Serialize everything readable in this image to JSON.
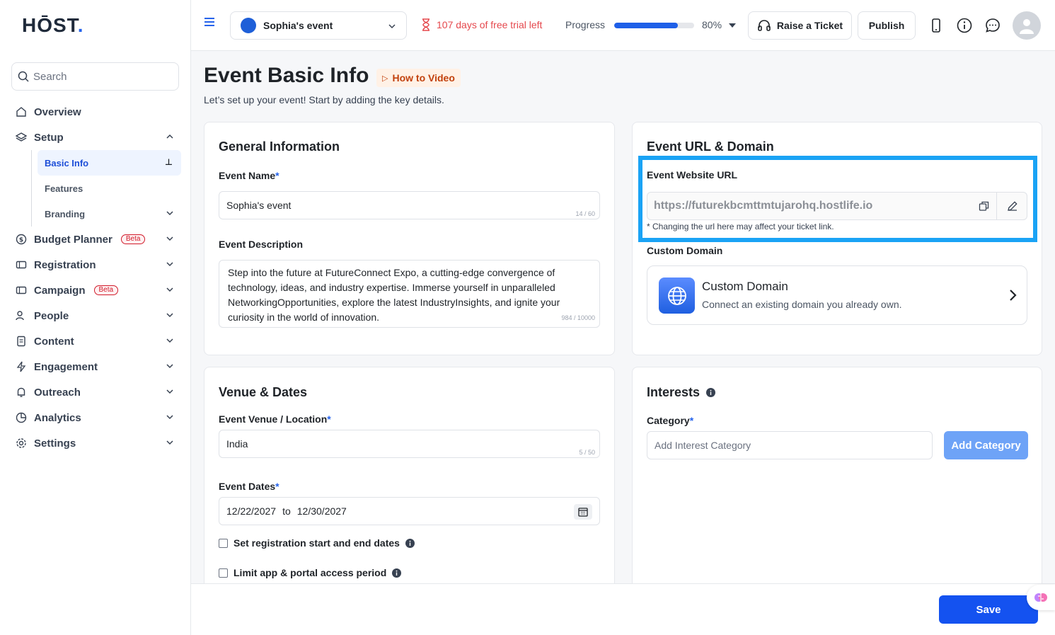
{
  "brand": {
    "logo_text": "HŌST",
    "logo_dot": "."
  },
  "colors": {
    "accent": "#2563eb",
    "primary_button": "#1452f0",
    "trial_red": "#e5484d",
    "highlight": "#1aa3f5"
  },
  "search": {
    "placeholder": "Search"
  },
  "sidebar": {
    "overview": "Overview",
    "setup": "Setup",
    "setup_items": [
      "Basic Info",
      "Features",
      "Branding"
    ],
    "budget_planner": "Budget Planner",
    "beta": "Beta",
    "registration": "Registration",
    "campaign": "Campaign",
    "people": "People",
    "content": "Content",
    "engagement": "Engagement",
    "outreach": "Outreach",
    "analytics": "Analytics",
    "settings": "Settings"
  },
  "header": {
    "event_name": "Sophia's event",
    "trial_text": "107 days of free trial left",
    "progress_label": "Progress",
    "progress_value": "80%",
    "progress_fraction": 0.8,
    "raise_ticket": "Raise a Ticket",
    "publish": "Publish"
  },
  "page": {
    "title": "Event Basic Info",
    "how_to": "How to Video",
    "subtitle": "Let’s set up your event! Start by adding the key details."
  },
  "general": {
    "title": "General Information",
    "name_label": "Event Name",
    "name_value": "Sophia's event",
    "name_counter": "14 / 60",
    "desc_label": "Event Description",
    "desc_value": "Step into the future at FutureConnect Expo, a cutting-edge convergence of technology, ideas, and industry expertise. Immerse yourself in unparalleled NetworkingOpportunities, explore the latest IndustryInsights, and ignite your curiosity in the world of innovation.",
    "desc_counter": "984 / 10000"
  },
  "url": {
    "title": "Event URL & Domain",
    "website_label": "Event Website URL",
    "website_value": "https://futurekbcmttmtujarohq.hostlife.io",
    "note": "* Changing the url here may affect your ticket link.",
    "custom_label": "Custom Domain",
    "custom_title": "Custom Domain",
    "custom_sub": "Connect an existing domain you already own."
  },
  "venue": {
    "title": "Venue & Dates",
    "location_label": "Event Venue / Location",
    "location_value": "India",
    "location_counter": "5 / 50",
    "dates_label": "Event Dates",
    "start_date": "12/22/2027",
    "to": "to",
    "end_date": "12/30/2027",
    "reg_dates": "Set registration start and end dates",
    "limit_access": "Limit app & portal access period"
  },
  "interests": {
    "title": "Interests",
    "category_label": "Category",
    "category_placeholder": "Add Interest Category",
    "add_button": "Add Category"
  },
  "footer": {
    "save": "Save"
  },
  "required_mark": "*"
}
